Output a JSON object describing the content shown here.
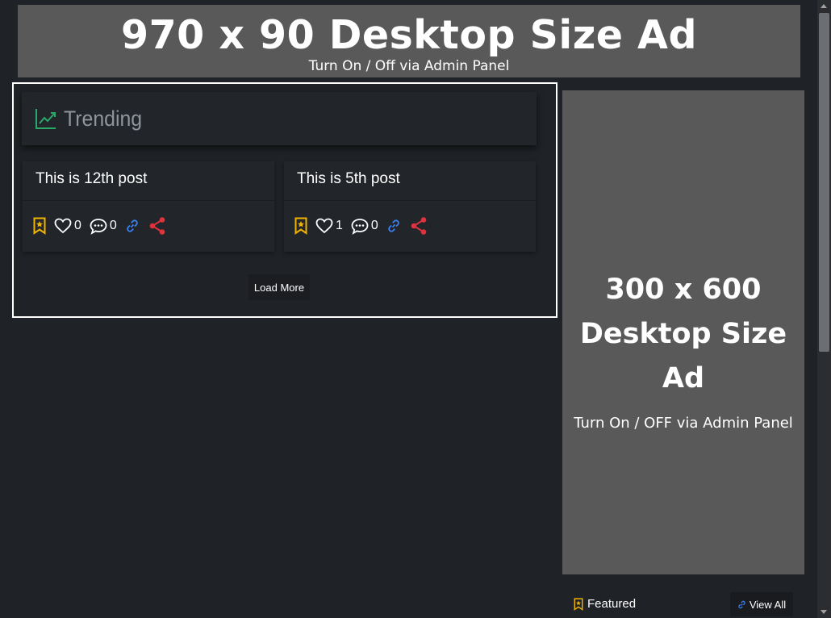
{
  "top_ad": {
    "title": "970 x 90 Desktop Size Ad",
    "subtitle": "Turn On / Off via Admin Panel"
  },
  "trending": {
    "heading": "Trending",
    "icon": "trending-up-icon",
    "posts": [
      {
        "title": "This is 12th post",
        "likes": "0",
        "comments": "0"
      },
      {
        "title": "This is 5th post",
        "likes": "1",
        "comments": "0"
      }
    ],
    "load_more_label": "Load More"
  },
  "side_ad": {
    "title_line1": "300 x 600",
    "title_line2": "Desktop Size Ad",
    "subtitle": "Turn On / OFF via Admin Panel"
  },
  "featured": {
    "label": "Featured",
    "view_all_label": "View All"
  },
  "colors": {
    "background": "#1f2226",
    "ad_gray": "#595959",
    "bookmark": "#f0b400",
    "link": "#3b82f6",
    "share": "#e0323c",
    "trend_icon": "#2aa86a"
  }
}
